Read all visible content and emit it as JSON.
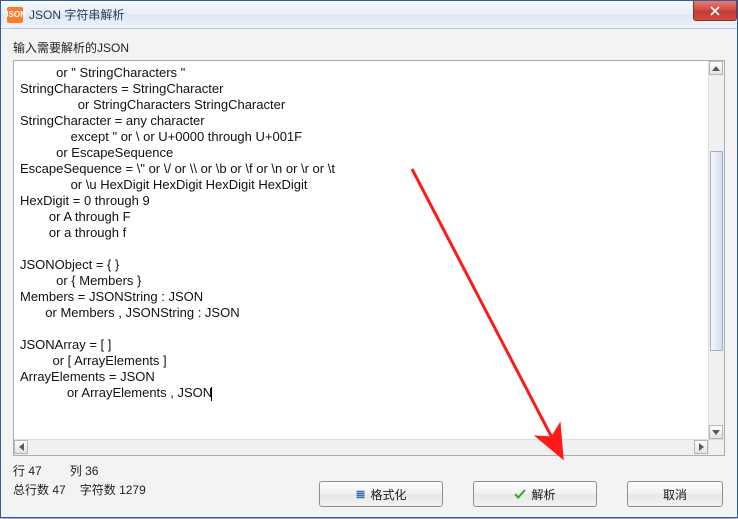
{
  "window": {
    "title": "JSON 字符串解析",
    "app_icon_text": "JSON"
  },
  "labels": {
    "input_prompt": "输入需要解析的JSON"
  },
  "editor": {
    "content": "          or \" StringCharacters \"\nStringCharacters = StringCharacter\n                or StringCharacters StringCharacter\nStringCharacter = any character\n              except \" or \\ or U+0000 through U+001F\n          or EscapeSequence\nEscapeSequence = \\\" or \\/ or \\\\ or \\b or \\f or \\n or \\r or \\t\n              or \\u HexDigit HexDigit HexDigit HexDigit\nHexDigit = 0 through 9\n        or A through F\n        or a through f\n\nJSONObject = { }\n          or { Members }\nMembers = JSONString : JSON\n       or Members , JSONString : JSON\n\nJSONArray = [ ]\n         or [ ArrayElements ]\nArrayElements = JSON\n             or ArrayElements , JSON"
  },
  "status": {
    "line_label": "行",
    "line_value": "47",
    "col_label": "列",
    "col_value": "36",
    "total_lines_label": "总行数",
    "total_lines_value": "47",
    "chars_label": "字符数",
    "chars_value": "1279"
  },
  "buttons": {
    "format": "格式化",
    "parse": "解析",
    "cancel": "取消"
  },
  "icons": {
    "format_glyph": "≣",
    "parse_check_color": "#2fa52f"
  }
}
